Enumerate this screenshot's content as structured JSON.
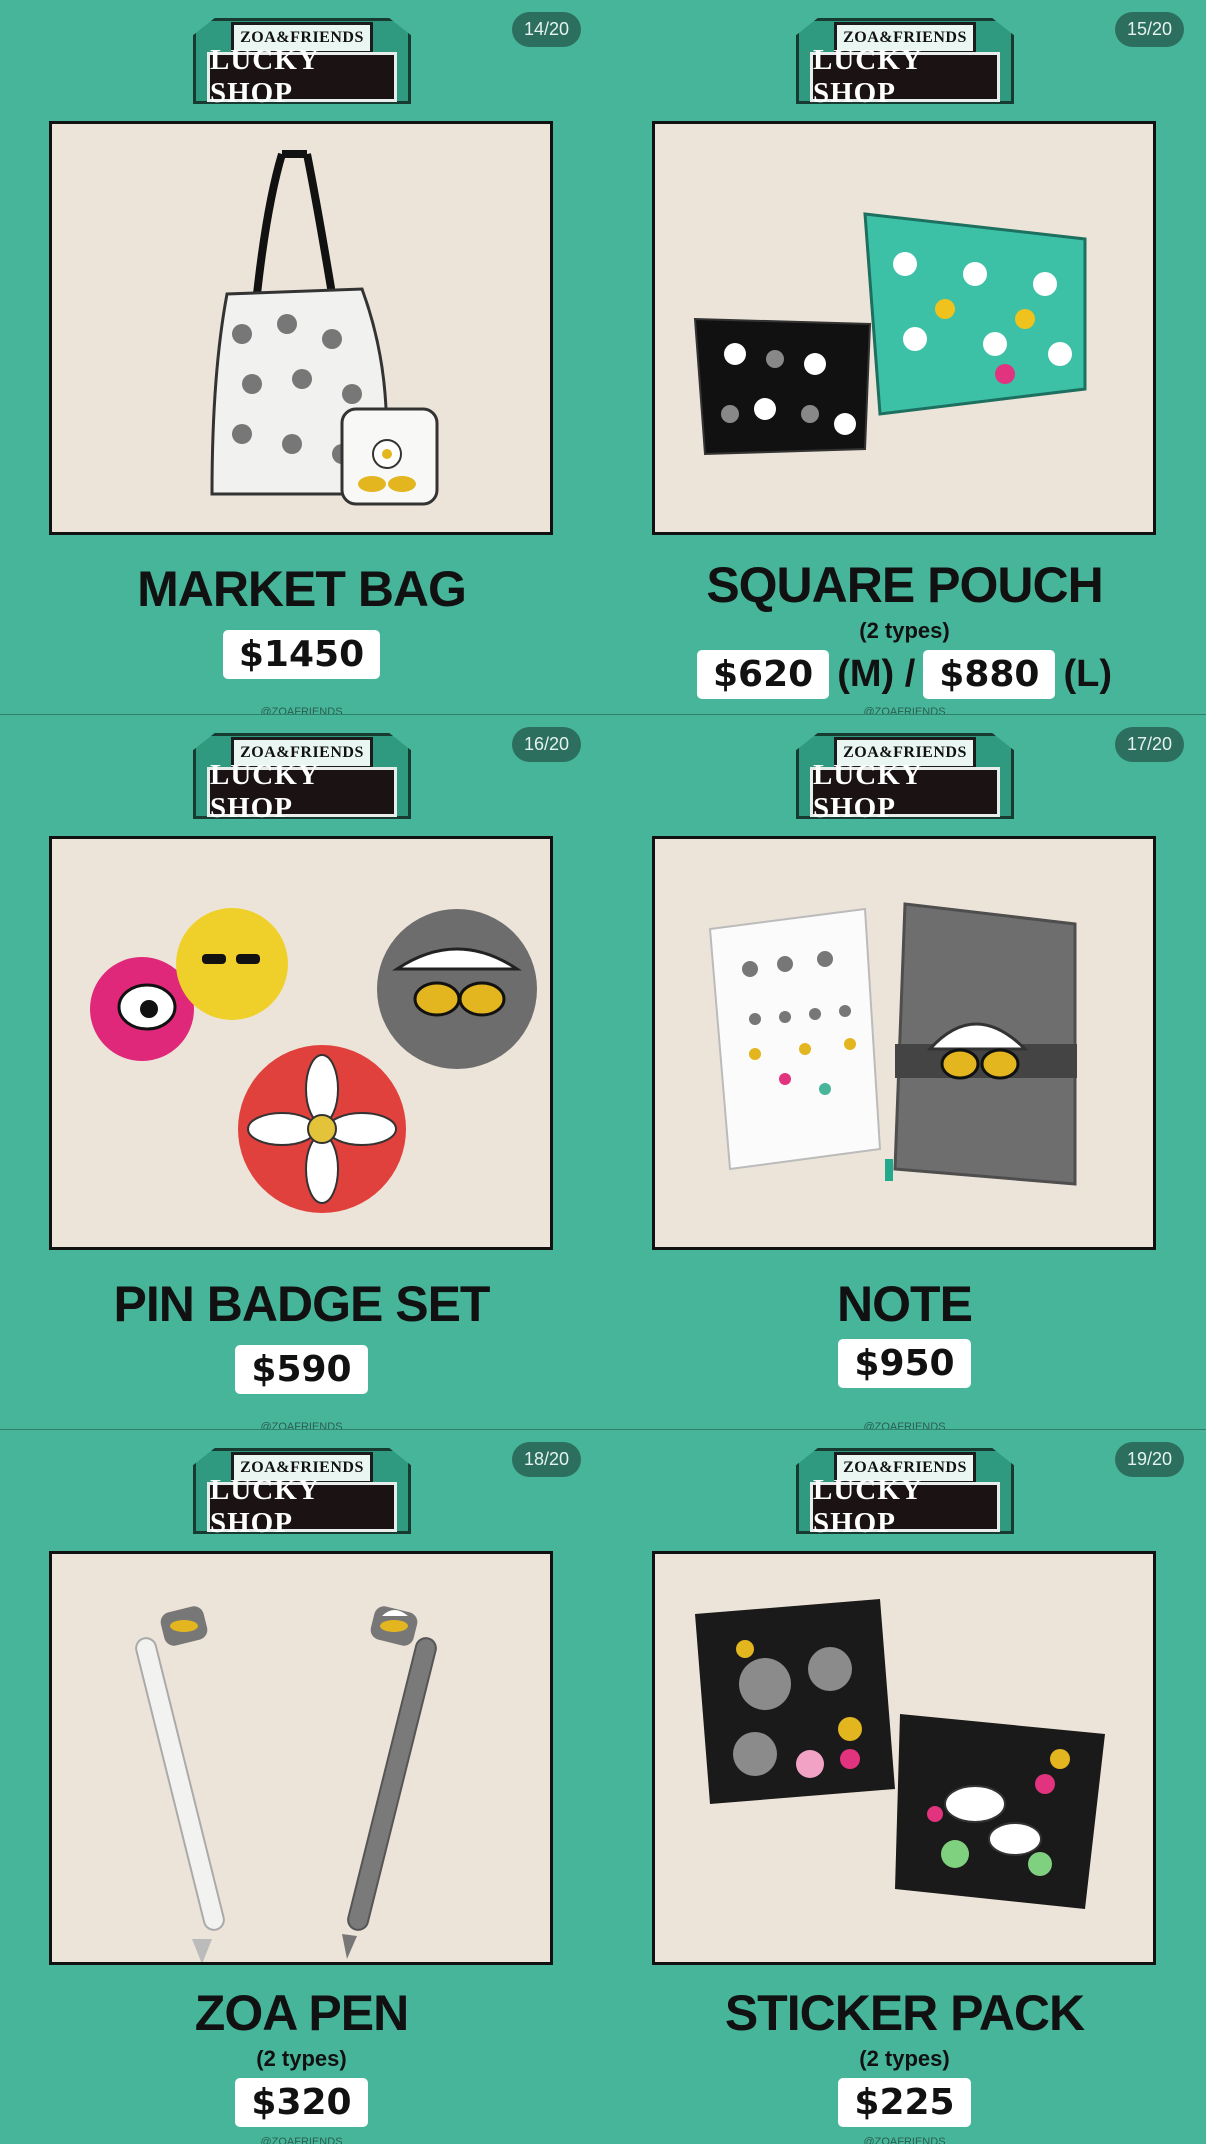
{
  "logo": {
    "top_text": "ZOA&FRIENDS",
    "main_text": "LUCKY SHOP"
  },
  "footer_handle": "@ZOAFRIENDS",
  "colors": {
    "background": "#46b59a",
    "badge": "#2d6f5f",
    "photo_bg": "#ede5da"
  },
  "items": [
    {
      "page": "14/20",
      "title": "MARKET BAG",
      "subtitle": "",
      "prices": [
        {
          "value": "$1450",
          "unit": ""
        }
      ]
    },
    {
      "page": "15/20",
      "title": "SQUARE POUCH",
      "subtitle": "(2 types)",
      "prices": [
        {
          "value": "$620",
          "unit": "(M) /"
        },
        {
          "value": "$880",
          "unit": "(L)"
        }
      ]
    },
    {
      "page": "16/20",
      "title": "PIN BADGE SET",
      "subtitle": "",
      "prices": [
        {
          "value": "$590",
          "unit": ""
        }
      ]
    },
    {
      "page": "17/20",
      "title": "NOTE",
      "subtitle": "",
      "prices": [
        {
          "value": "$950",
          "unit": ""
        }
      ]
    },
    {
      "page": "18/20",
      "title": "ZOA PEN",
      "subtitle": "(2 types)",
      "prices": [
        {
          "value": "$320",
          "unit": ""
        }
      ]
    },
    {
      "page": "19/20",
      "title": "STICKER PACK",
      "subtitle": "(2 types)",
      "prices": [
        {
          "value": "$225",
          "unit": ""
        }
      ]
    }
  ],
  "images": [
    "market-bag-photo",
    "square-pouch-photo",
    "pin-badge-photo",
    "note-photo",
    "zoa-pen-photo",
    "sticker-pack-photo"
  ]
}
